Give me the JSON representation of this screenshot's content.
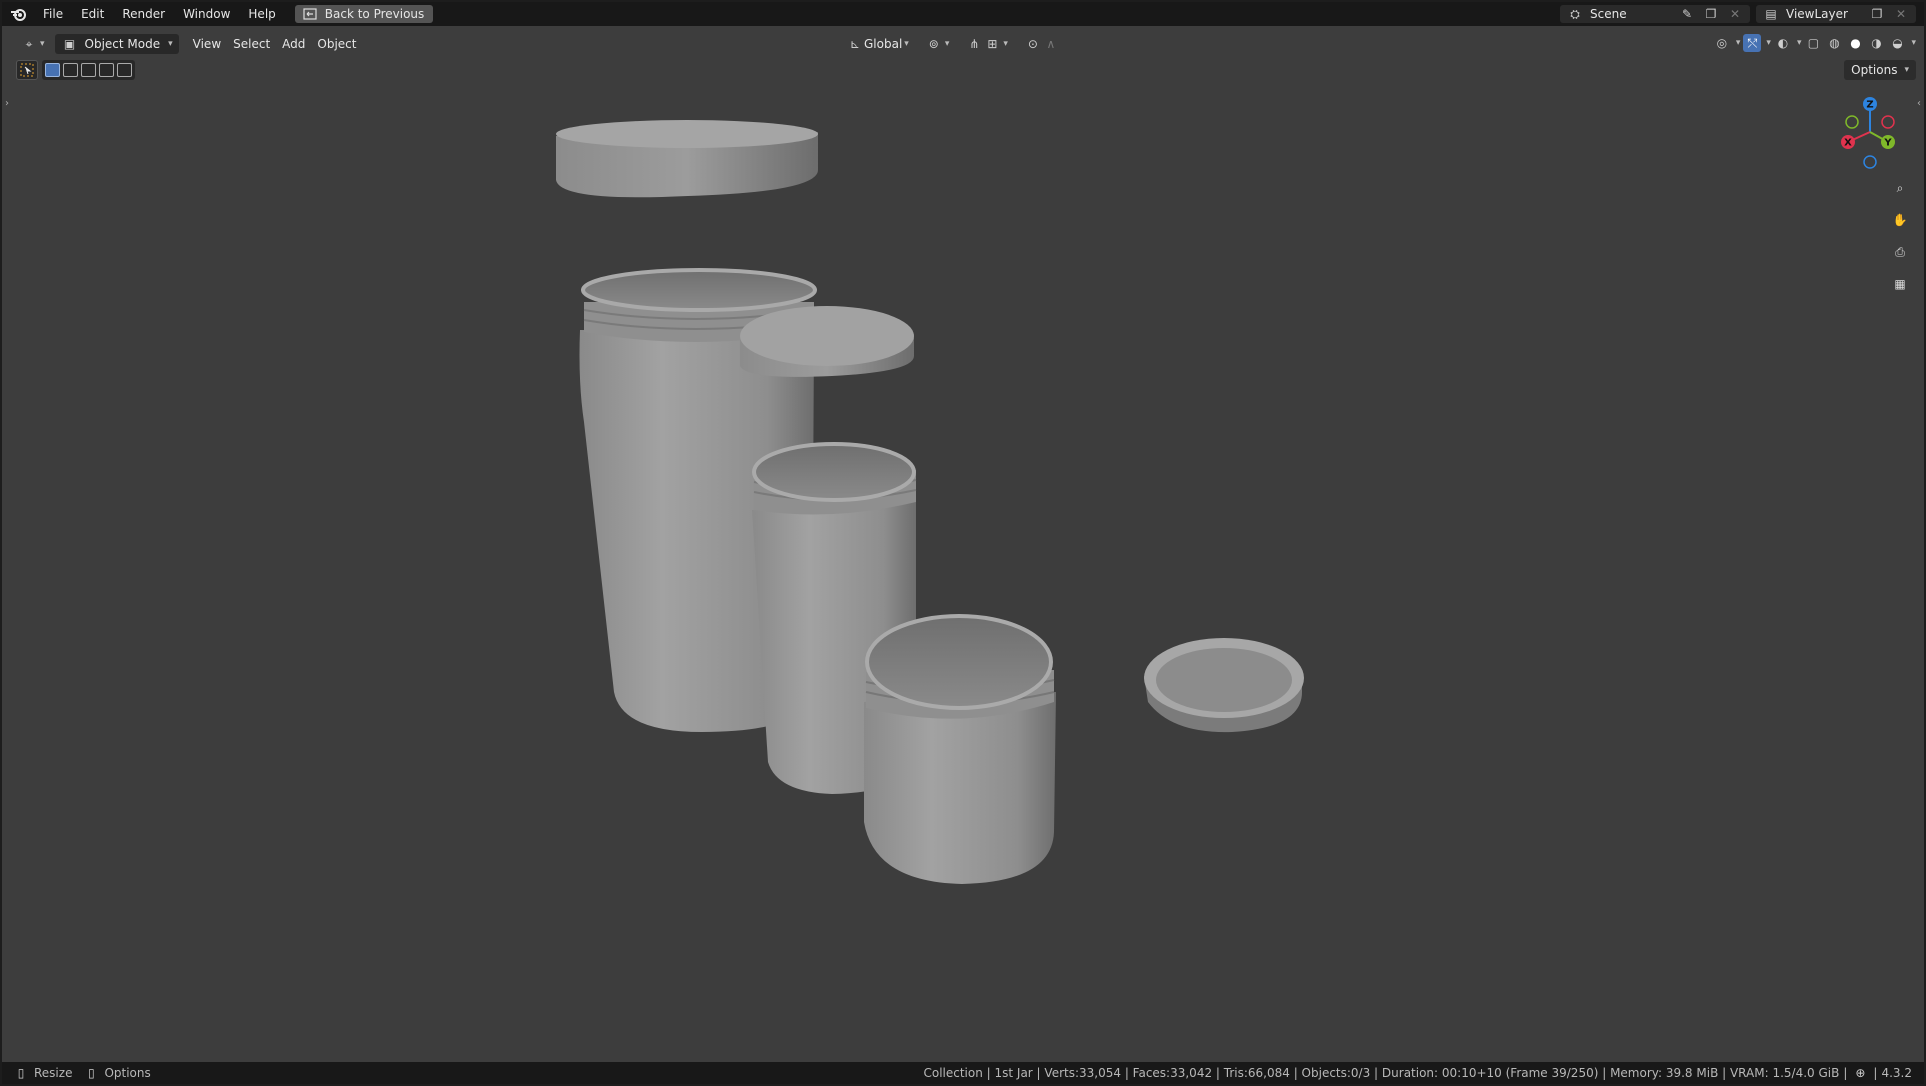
{
  "menu": {
    "items": [
      "File",
      "Edit",
      "Render",
      "Window",
      "Help"
    ],
    "back_button": "Back to Previous"
  },
  "top_right": {
    "scene_label": "Scene",
    "view_layer_label": "ViewLayer"
  },
  "header": {
    "mode_label": "Object Mode",
    "menus": [
      "View",
      "Select",
      "Add",
      "Object"
    ],
    "orientation_label": "Global",
    "options_label": "Options"
  },
  "gizmo": {
    "x_label": "X",
    "y_label": "Y",
    "z_label": "Z",
    "colors": {
      "x": "#e0334e",
      "y": "#7fb82a",
      "z": "#2d84e0"
    }
  },
  "status": {
    "resize_label": "Resize",
    "options_label": "Options",
    "info": "Collection | 1st Jar | Verts:33,054 | Faces:33,042 | Tris:66,084 | Objects:0/3 | Duration: 00:10+10 (Frame 39/250) | Memory: 39.8 MiB | VRAM: 1.5/4.0 GiB",
    "version": "4.3.2"
  },
  "icons": [
    "blender-logo-icon",
    "back-icon",
    "editor-type-icon",
    "object-mode-icon",
    "orientation-icon",
    "pivot-icon",
    "snap-icon",
    "proportional-icon",
    "visibility-icon",
    "gizmo-icon",
    "overlay-icon",
    "xray-icon",
    "wireframe-shading-icon",
    "solid-shading-icon",
    "material-shading-icon",
    "rendered-shading-icon",
    "zoom-icon",
    "hand-icon",
    "camera-icon",
    "grid-icon",
    "select-box-icon"
  ]
}
